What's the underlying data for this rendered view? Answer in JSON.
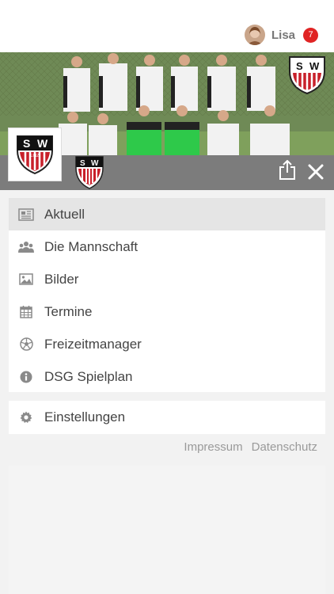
{
  "user": {
    "name": "Lisa",
    "notification_count": "7",
    "avatar_icon": "user-avatar"
  },
  "club": {
    "logo_top": "S",
    "logo_right": "W",
    "logo_bottom": "LINZ"
  },
  "actions": {
    "share_icon": "share-icon",
    "close_icon": "close-icon"
  },
  "menu": {
    "items": [
      {
        "label": "Aktuell",
        "icon": "newspaper-icon",
        "active": true
      },
      {
        "label": "Die Mannschaft",
        "icon": "users-icon",
        "active": false
      },
      {
        "label": "Bilder",
        "icon": "image-icon",
        "active": false
      },
      {
        "label": "Termine",
        "icon": "calendar-icon",
        "active": false
      },
      {
        "label": "Freizeitmanager",
        "icon": "soccer-ball-icon",
        "active": false
      },
      {
        "label": "DSG Spielplan",
        "icon": "info-icon",
        "active": false
      }
    ],
    "settings": {
      "label": "Einstellungen",
      "icon": "gear-icon"
    }
  },
  "footer": {
    "impressum": "Impressum",
    "datenschutz": "Datenschutz"
  },
  "colors": {
    "accent_red": "#e02424",
    "bar_gray": "#7c7c7c",
    "active_bg": "#e5e5e5"
  }
}
